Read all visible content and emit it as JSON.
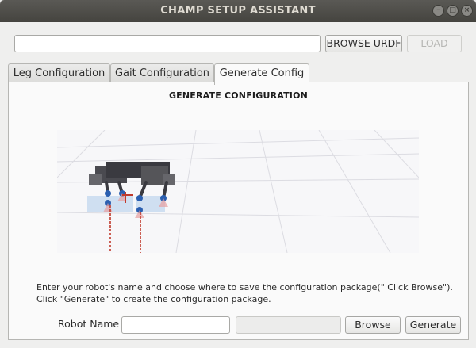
{
  "window": {
    "title": "CHAMP SETUP ASSISTANT",
    "controls": [
      "minimize-icon",
      "maximize-icon",
      "close-icon"
    ]
  },
  "toolbar": {
    "urdf_path_value": "",
    "browse_urdf_label": "BROWSE URDF",
    "load_label": "LOAD"
  },
  "tabs": [
    {
      "label": "Leg Configuration",
      "active": false
    },
    {
      "label": "Gait Configuration",
      "active": false
    },
    {
      "label": "Generate Config",
      "active": true
    }
  ],
  "generate": {
    "heading": "GENERATE CONFIGURATION",
    "instructions_line1": "Enter your robot's name and choose where to save the configuration package(\" Click Browse\").",
    "instructions_line2": "Click \"Generate\" to create the configuration package.",
    "robot_name_label": "Robot Name",
    "robot_name_value": "",
    "package_path_value": "",
    "browse_label": "Browse",
    "generate_label": "Generate"
  },
  "colors": {
    "titlebar": "#4d4c48",
    "window_bg": "#efefee",
    "panel_bg": "#fafafa",
    "joint_blue": "#2b5fb0",
    "axis_red": "#c0392b"
  }
}
